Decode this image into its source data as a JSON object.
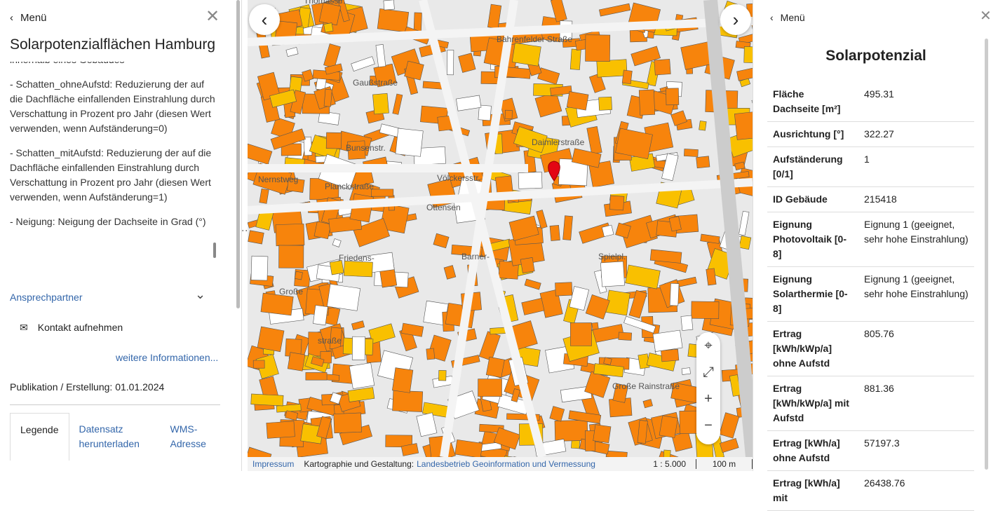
{
  "left": {
    "menu": "Menü",
    "title": "Solarpotenzialflächen Hamburg",
    "desc_cut": "innerhalb eines Gebäudes",
    "desc": [
      "- Schatten_ohneAufstd: Reduzierung der auf die Dachfläche einfallenden Einstrahlung durch Verschattung in Prozent pro Jahr (diesen Wert verwenden, wenn Aufständerung=0)",
      "- Schatten_mitAufstd: Reduzierung der auf die Dachfläche einfallenden Einstrahlung durch Verschattung in Prozent pro Jahr (diesen Wert verwenden, wenn Aufständerung=1)",
      "- Neigung: Neigung der Dachseite in Grad (°)"
    ],
    "contact_header": "Ansprechpartner",
    "contact": "Kontakt aufnehmen",
    "more": "weitere Informationen...",
    "publication": "Publikation / Erstellung: 01.01.2024",
    "tabs": [
      "Legende",
      "Datensatz herunterladen",
      "WMS-Adresse"
    ]
  },
  "map": {
    "labels": [
      "Gaußstraße",
      "Bahrenfelder Straße",
      "Bunsenstr.",
      "Planckstraße",
      "Völckersstr.",
      "Ottensen",
      "Friedens-",
      "Barner-",
      "straße",
      "Nernstweg",
      "Große",
      "Daimlerstraße",
      "Spielpl.",
      "Thomasstr.",
      "Große Rainstraße"
    ],
    "footer": {
      "impressum": "Impressum",
      "carto": "Kartographie und Gestaltung:",
      "agency": "Landesbetrieb Geoinformation und Vermessung",
      "scale": "1 : 5.000",
      "distance": "100 m"
    }
  },
  "right": {
    "menu": "Menü",
    "title": "Solarpotenzial",
    "rows": [
      [
        "Fläche Dachseite [m²]",
        "495.31"
      ],
      [
        "Ausrichtung [°]",
        "322.27"
      ],
      [
        "Aufständerung [0/1]",
        "1"
      ],
      [
        "ID Gebäude",
        "215418"
      ],
      [
        "Eignung Photovoltaik [0-8]",
        "Eignung 1 (geeignet, sehr hohe Einstrahlung)"
      ],
      [
        "Eignung Solarthermie [0-8]",
        "Eignung 1 (geeignet, sehr hohe Einstrahlung)"
      ],
      [
        "Ertrag [kWh/kWp/a] ohne Aufstd",
        "805.76"
      ],
      [
        "Ertrag [kWh/kWp/a] mit Aufstd",
        "881.36"
      ],
      [
        "Ertrag [kWh/a] ohne Aufstd",
        "57197.3"
      ],
      [
        "Ertrag [kWh/a] mit",
        "26438.76"
      ]
    ]
  },
  "colors": {
    "roof": "#f7840c",
    "roof_light": "#f9c000",
    "link": "#3366aa",
    "marker": "#e30613"
  }
}
